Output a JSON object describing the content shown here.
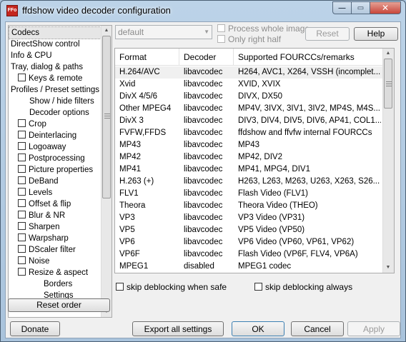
{
  "window": {
    "title": "ffdshow video decoder configuration",
    "icon_text": "FFo",
    "caption": {
      "minimize": "—",
      "maximize": "▭",
      "close": "✕"
    }
  },
  "tree": {
    "items": [
      {
        "label": "Codecs",
        "checkbox": false,
        "indent": 0,
        "selected": true
      },
      {
        "label": "DirectShow control",
        "checkbox": false,
        "indent": 0
      },
      {
        "label": "Info & CPU",
        "checkbox": false,
        "indent": 0
      },
      {
        "label": "Tray, dialog & paths",
        "checkbox": false,
        "indent": 0
      },
      {
        "label": "Keys & remote",
        "checkbox": true,
        "indent": 1
      },
      {
        "label": "Profiles / Preset settings",
        "checkbox": false,
        "indent": 0
      },
      {
        "label": "Show / hide filters",
        "checkbox": false,
        "indent": 2
      },
      {
        "label": "Decoder options",
        "checkbox": false,
        "indent": 2
      },
      {
        "label": "Crop",
        "checkbox": true,
        "indent": 1
      },
      {
        "label": "Deinterlacing",
        "checkbox": true,
        "indent": 1
      },
      {
        "label": "Logoaway",
        "checkbox": true,
        "indent": 1
      },
      {
        "label": "Postprocessing",
        "checkbox": true,
        "indent": 1
      },
      {
        "label": "Picture properties",
        "checkbox": true,
        "indent": 1
      },
      {
        "label": "DeBand",
        "checkbox": true,
        "indent": 1
      },
      {
        "label": "Levels",
        "checkbox": true,
        "indent": 1
      },
      {
        "label": "Offset & flip",
        "checkbox": true,
        "indent": 1
      },
      {
        "label": "Blur & NR",
        "checkbox": true,
        "indent": 1
      },
      {
        "label": "Sharpen",
        "checkbox": true,
        "indent": 1
      },
      {
        "label": "Warpsharp",
        "checkbox": true,
        "indent": 1
      },
      {
        "label": "DScaler filter",
        "checkbox": true,
        "indent": 1
      },
      {
        "label": "Noise",
        "checkbox": true,
        "indent": 1
      },
      {
        "label": "Resize & aspect",
        "checkbox": true,
        "indent": 1
      },
      {
        "label": "Borders",
        "checkbox": false,
        "indent": 3
      },
      {
        "label": "Settings",
        "checkbox": false,
        "indent": 3
      }
    ]
  },
  "preset": {
    "value": "default",
    "process_whole_image": "Process whole image",
    "only_right_half": "Only right half",
    "reset_label": "Reset",
    "help_label": "Help"
  },
  "grid": {
    "headers": [
      "Format",
      "Decoder",
      "Supported FOURCCs/remarks"
    ],
    "rows": [
      {
        "format": "H.264/AVC",
        "decoder": "libavcodec",
        "remarks": "H264, AVC1, X264, VSSH (incomplet..."
      },
      {
        "format": "Xvid",
        "decoder": "libavcodec",
        "remarks": "XVID, XVIX"
      },
      {
        "format": "DivX 4/5/6",
        "decoder": "libavcodec",
        "remarks": "DIVX, DX50"
      },
      {
        "format": "Other MPEG4",
        "decoder": "libavcodec",
        "remarks": "MP4V, 3IVX, 3IV1, 3IV2, MP4S, M4S..."
      },
      {
        "format": "DivX 3",
        "decoder": "libavcodec",
        "remarks": "DIV3, DIV4, DIV5, DIV6, AP41, COL1..."
      },
      {
        "format": "FVFW,FFDS",
        "decoder": "libavcodec",
        "remarks": "ffdshow and ffvfw internal FOURCCs"
      },
      {
        "format": "MP43",
        "decoder": "libavcodec",
        "remarks": "MP43"
      },
      {
        "format": "MP42",
        "decoder": "libavcodec",
        "remarks": "MP42, DIV2"
      },
      {
        "format": "MP41",
        "decoder": "libavcodec",
        "remarks": "MP41, MPG4, DIV1"
      },
      {
        "format": "H.263 (+)",
        "decoder": "libavcodec",
        "remarks": "H263, L263, M263, U263, X263, S26..."
      },
      {
        "format": "FLV1",
        "decoder": "libavcodec",
        "remarks": "Flash Video (FLV1)"
      },
      {
        "format": "Theora",
        "decoder": "libavcodec",
        "remarks": "Theora Video (THEO)"
      },
      {
        "format": "VP3",
        "decoder": "libavcodec",
        "remarks": "VP3 Video (VP31)"
      },
      {
        "format": "VP5",
        "decoder": "libavcodec",
        "remarks": "VP5 Video (VP50)"
      },
      {
        "format": "VP6",
        "decoder": "libavcodec",
        "remarks": "VP6 Video (VP60, VP61, VP62)"
      },
      {
        "format": "VP6F",
        "decoder": "libavcodec",
        "remarks": "Flash Video (VP6F, FLV4, VP6A)"
      },
      {
        "format": "MPEG1",
        "decoder": "disabled",
        "remarks": "MPEG1 codec"
      }
    ]
  },
  "options": {
    "skip_deblock_safe": "skip deblocking when safe",
    "skip_deblock_always": "skip deblocking always"
  },
  "buttons": {
    "reset_order": "Reset order",
    "donate": "Donate",
    "export_all": "Export all settings",
    "ok": "OK",
    "cancel": "Cancel",
    "apply": "Apply"
  }
}
